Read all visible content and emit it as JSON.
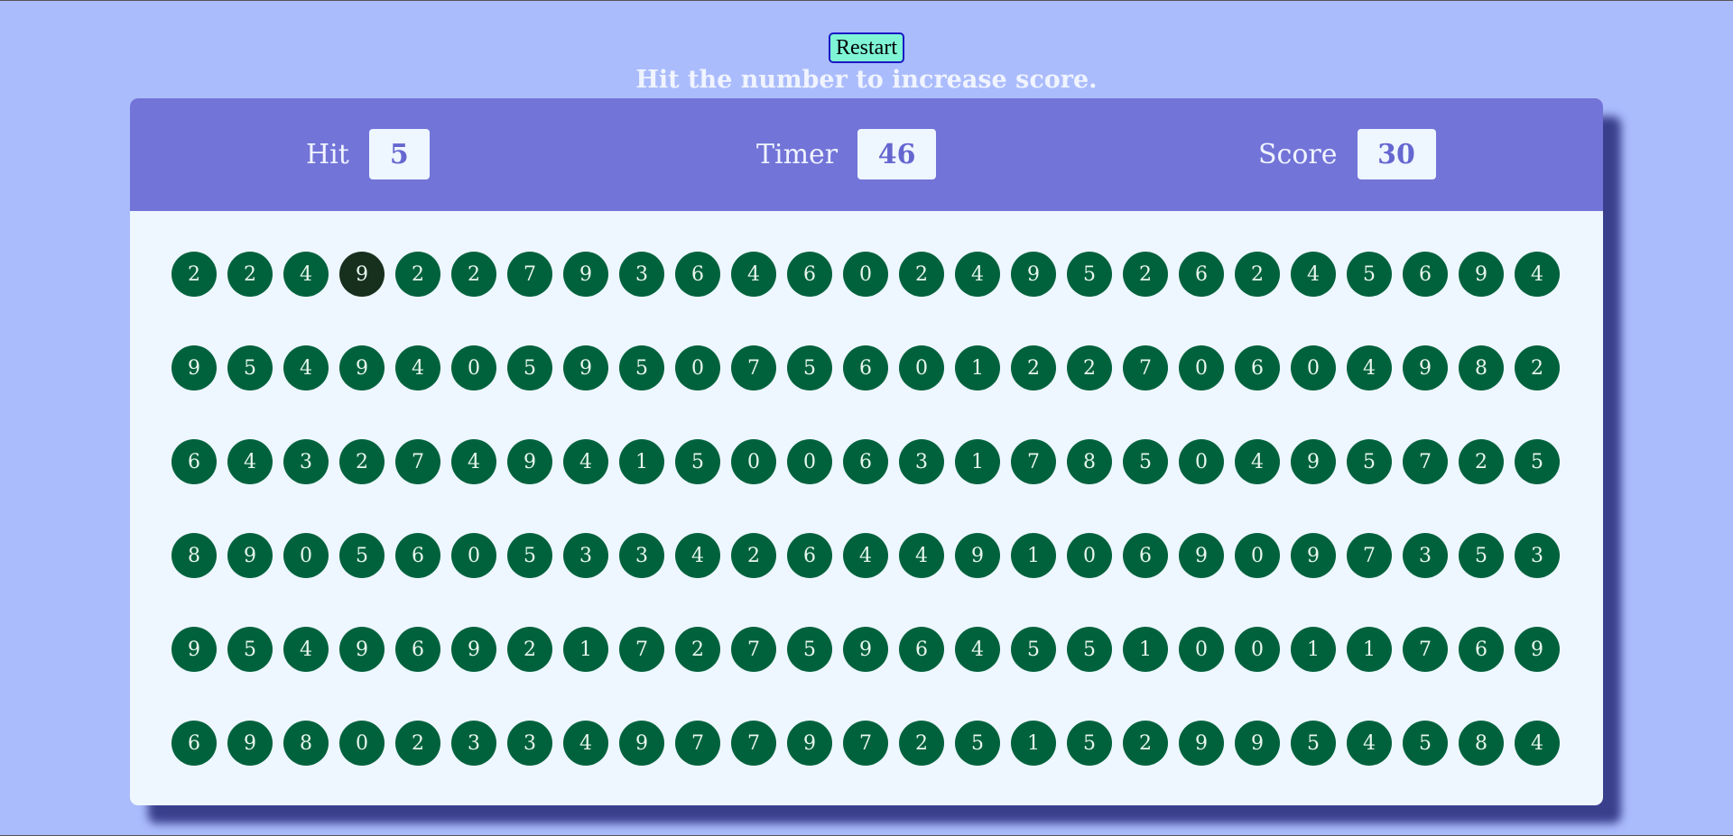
{
  "controls": {
    "restart_label": "Restart",
    "instruction": "Hit the number to increase score."
  },
  "stats": {
    "hit_label": "Hit",
    "hit_value": "5",
    "timer_label": "Timer",
    "timer_value": "46",
    "score_label": "Score",
    "score_value": "30"
  },
  "board": {
    "hovered": [
      0,
      3
    ],
    "rows": [
      [
        "2",
        "2",
        "4",
        "9",
        "2",
        "2",
        "7",
        "9",
        "3",
        "6",
        "4",
        "6",
        "0",
        "2",
        "4",
        "9",
        "5",
        "2",
        "6",
        "2",
        "4",
        "5",
        "6",
        "9",
        "4"
      ],
      [
        "9",
        "5",
        "4",
        "9",
        "4",
        "0",
        "5",
        "9",
        "5",
        "0",
        "7",
        "5",
        "6",
        "0",
        "1",
        "2",
        "2",
        "7",
        "0",
        "6",
        "0",
        "4",
        "9",
        "8",
        "2"
      ],
      [
        "6",
        "4",
        "3",
        "2",
        "7",
        "4",
        "9",
        "4",
        "1",
        "5",
        "0",
        "0",
        "6",
        "3",
        "1",
        "7",
        "8",
        "5",
        "0",
        "4",
        "9",
        "5",
        "7",
        "2",
        "5"
      ],
      [
        "8",
        "9",
        "0",
        "5",
        "6",
        "0",
        "5",
        "3",
        "3",
        "4",
        "2",
        "6",
        "4",
        "4",
        "9",
        "1",
        "0",
        "6",
        "9",
        "0",
        "9",
        "7",
        "3",
        "5",
        "3"
      ],
      [
        "9",
        "5",
        "4",
        "9",
        "6",
        "9",
        "2",
        "1",
        "7",
        "2",
        "7",
        "5",
        "9",
        "6",
        "4",
        "5",
        "5",
        "1",
        "0",
        "0",
        "1",
        "1",
        "7",
        "6",
        "9"
      ],
      [
        "6",
        "9",
        "8",
        "0",
        "2",
        "3",
        "3",
        "4",
        "9",
        "7",
        "7",
        "9",
        "7",
        "2",
        "5",
        "1",
        "5",
        "2",
        "9",
        "9",
        "5",
        "4",
        "5",
        "8",
        "4"
      ]
    ]
  },
  "colors": {
    "background": "#abbcfd",
    "header": "#7274d8",
    "panel": "#eef6ff",
    "bubble": "#00623d",
    "bubble_hover": "#17301e",
    "restart_bg": "#7ff5d6"
  }
}
